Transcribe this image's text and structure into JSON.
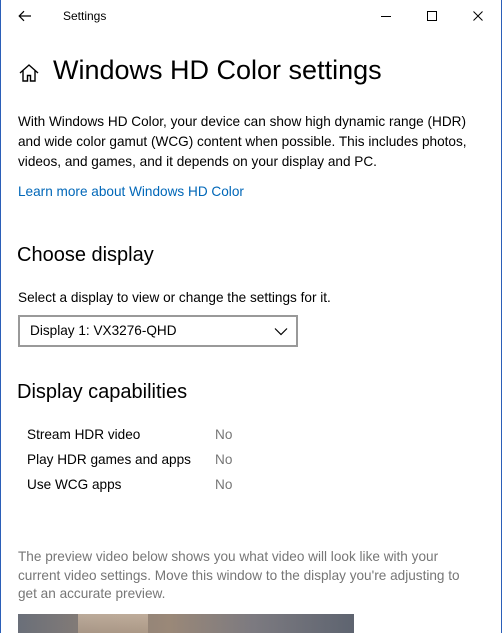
{
  "window": {
    "title": "Settings"
  },
  "header": {
    "title": "Windows HD Color settings",
    "intro": "With Windows HD Color, your device can show high dynamic range (HDR) and wide color gamut (WCG) content when possible. This includes photos, videos, and games, and it depends on your display and PC.",
    "learn_more": "Learn more about Windows HD Color"
  },
  "choose_display": {
    "heading": "Choose display",
    "label": "Select a display to view or change the settings for it.",
    "selected": "Display 1: VX3276-QHD"
  },
  "capabilities": {
    "heading": "Display capabilities",
    "rows": [
      {
        "label": "Stream HDR video",
        "value": "No"
      },
      {
        "label": "Play HDR games and apps",
        "value": "No"
      },
      {
        "label": "Use WCG apps",
        "value": "No"
      }
    ]
  },
  "preview": {
    "note": "The preview video below shows you what video will look like with your current video settings. Move this window to the display you're adjusting to get an accurate preview."
  },
  "colors": {
    "link": "#0067b8",
    "muted_text": "#767676",
    "border": "#999999"
  },
  "icons": {
    "back": "back-arrow-icon",
    "minimize": "minimize-icon",
    "maximize": "maximize-icon",
    "close": "close-icon",
    "home": "home-icon",
    "dropdown": "chevron-down-icon"
  }
}
